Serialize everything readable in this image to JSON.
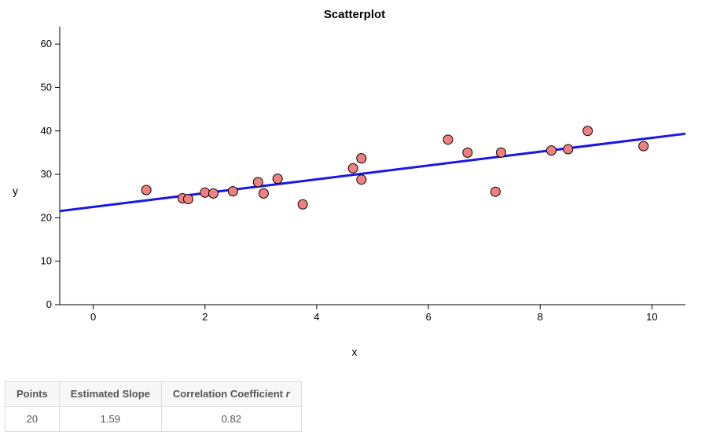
{
  "chart_data": {
    "type": "scatter",
    "title": "Scatterplot",
    "xlabel": "x",
    "ylabel": "y",
    "xlim": [
      -0.6,
      10.6
    ],
    "ylim": [
      0,
      64
    ],
    "xticks": [
      0,
      2,
      4,
      6,
      8,
      10
    ],
    "yticks": [
      0,
      10,
      20,
      30,
      40,
      50,
      60
    ],
    "points": [
      {
        "x": 0.95,
        "y": 26.4
      },
      {
        "x": 1.6,
        "y": 24.5
      },
      {
        "x": 1.7,
        "y": 24.3
      },
      {
        "x": 2.0,
        "y": 25.8
      },
      {
        "x": 2.15,
        "y": 25.6
      },
      {
        "x": 2.5,
        "y": 26.1
      },
      {
        "x": 2.95,
        "y": 28.2
      },
      {
        "x": 3.05,
        "y": 25.6
      },
      {
        "x": 3.3,
        "y": 29.0
      },
      {
        "x": 3.75,
        "y": 23.1
      },
      {
        "x": 4.65,
        "y": 31.4
      },
      {
        "x": 4.8,
        "y": 33.7
      },
      {
        "x": 4.8,
        "y": 28.8
      },
      {
        "x": 6.35,
        "y": 38.0
      },
      {
        "x": 6.7,
        "y": 35.0
      },
      {
        "x": 7.2,
        "y": 26.0
      },
      {
        "x": 7.3,
        "y": 35.0
      },
      {
        "x": 8.2,
        "y": 35.5
      },
      {
        "x": 8.5,
        "y": 35.8
      },
      {
        "x": 8.85,
        "y": 40.0
      },
      {
        "x": 9.85,
        "y": 36.5
      }
    ],
    "regression": {
      "intercept": 22.5,
      "slope": 1.59,
      "x0": -0.6,
      "x1": 10.6,
      "color": "#1818e6"
    },
    "point_style": {
      "fill": "#f08080",
      "stroke": "#000",
      "r": 6
    }
  },
  "stats": {
    "headers": {
      "points": "Points",
      "slope": "Estimated Slope",
      "corr_prefix": "Correlation Coefficient ",
      "corr_symbol": "r"
    },
    "values": {
      "points": "20",
      "slope": "1.59",
      "corr": "0.82"
    }
  }
}
